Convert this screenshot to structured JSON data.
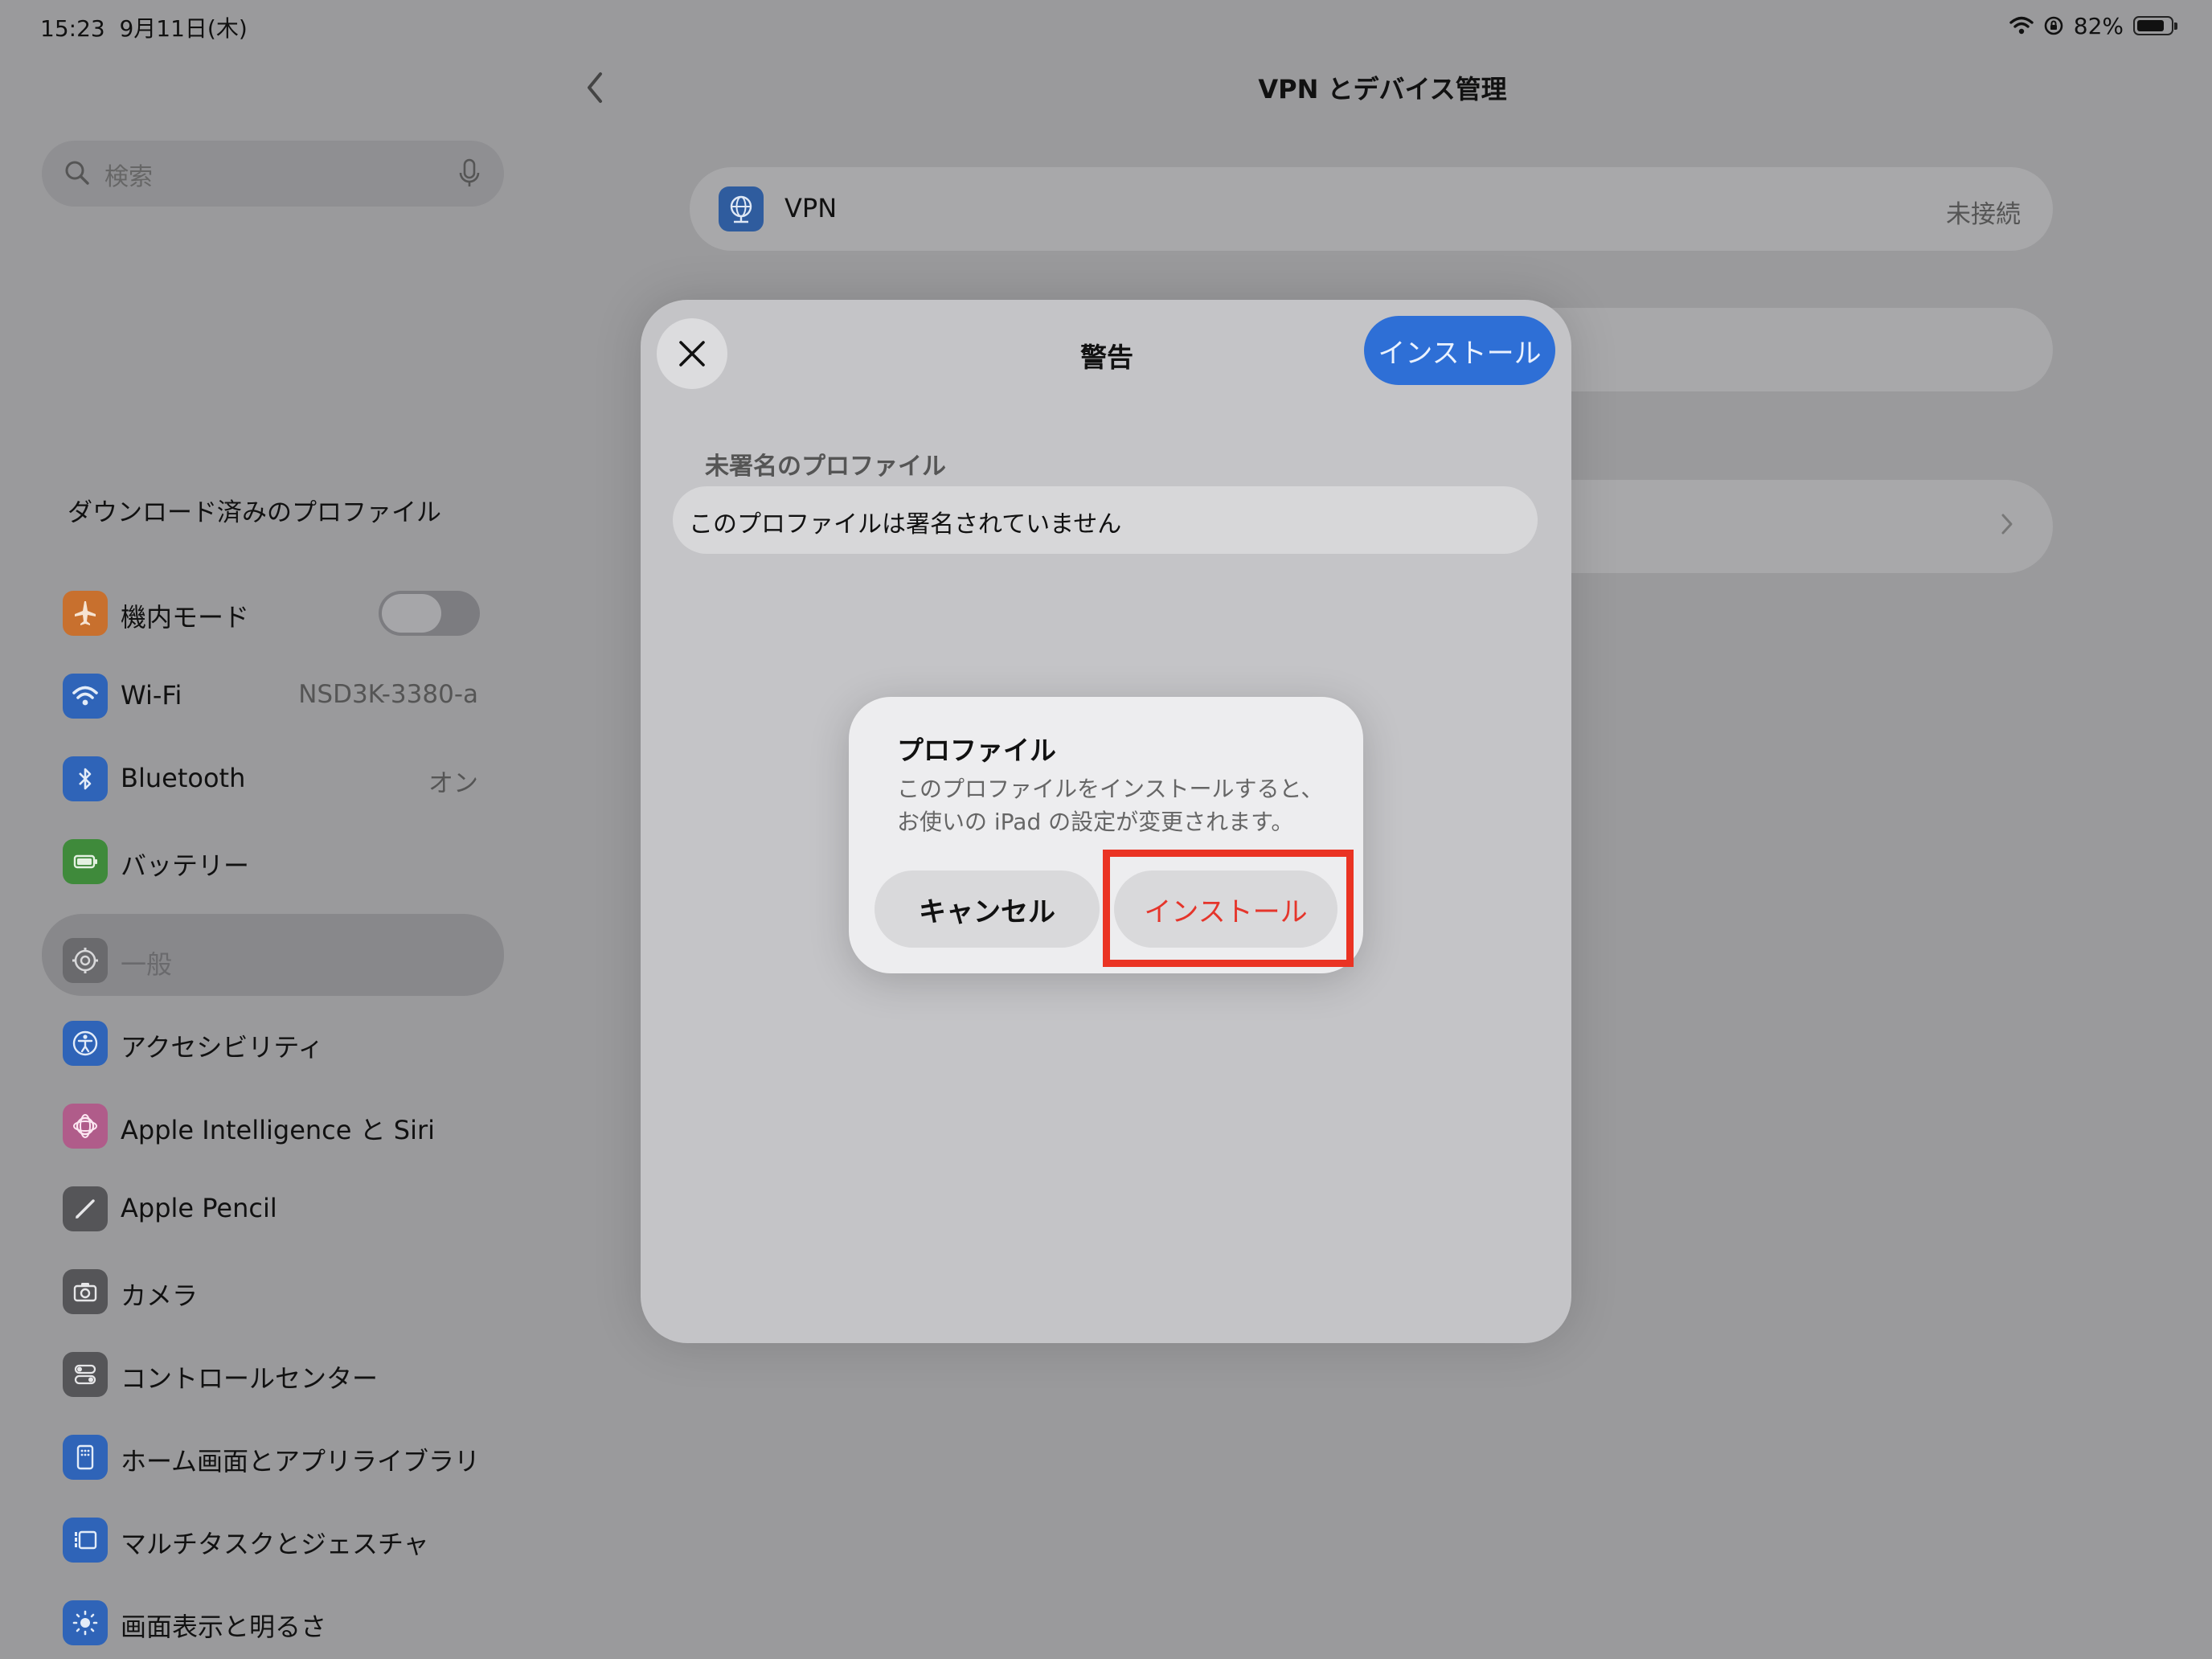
{
  "status_bar": {
    "time_date": "15:23  9月11日(木)",
    "battery_percent": "82%",
    "battery_level": 0.82
  },
  "sidebar": {
    "search_placeholder": "検索",
    "downloaded_profile": "ダウンロード済みのプロファイル",
    "items": [
      {
        "label": "機内モード",
        "icon": "airplane-icon",
        "color": "#c8702e",
        "toggle_on": false
      },
      {
        "label": "Wi-Fi",
        "value": "NSD3K-3380-a",
        "icon": "wifi-icon",
        "color": "#2f64b8"
      },
      {
        "label": "Bluetooth",
        "value": "オン",
        "icon": "bluetooth-icon",
        "color": "#2f64b8"
      },
      {
        "label": "バッテリー",
        "icon": "battery-icon",
        "color": "#3f8a3b"
      },
      {
        "label": "一般",
        "icon": "gear-icon",
        "color": "#6a6a6d",
        "selected": true
      },
      {
        "label": "アクセシビリティ",
        "icon": "accessibility-icon",
        "color": "#2f64b8"
      },
      {
        "label": "Apple Intelligence と Siri",
        "icon": "siri-icon",
        "color": "#b05c8a"
      },
      {
        "label": "Apple Pencil",
        "icon": "pencil-icon",
        "color": "#555558"
      },
      {
        "label": "カメラ",
        "icon": "camera-icon",
        "color": "#555558"
      },
      {
        "label": "コントロールセンター",
        "icon": "control-center-icon",
        "color": "#555558"
      },
      {
        "label": "ホーム画面とアプリライブラリ",
        "icon": "home-screen-icon",
        "color": "#2f64b8"
      },
      {
        "label": "マルチタスクとジェスチャ",
        "icon": "multitask-icon",
        "color": "#2f64b8"
      },
      {
        "label": "画面表示と明るさ",
        "icon": "brightness-icon",
        "color": "#2f64b8"
      }
    ]
  },
  "main": {
    "title": "VPN とデバイス管理",
    "vpn_label": "VPN",
    "vpn_status": "未接続"
  },
  "sheet": {
    "title": "警告",
    "install_label": "インストール",
    "section_header": "未署名のプロファイル",
    "unsigned_text": "このプロファイルは署名されていません"
  },
  "alert": {
    "title": "プロファイル",
    "message_line1": "このプロファイルをインストールすると、",
    "message_line2": "お使いの iPad の設定が変更されます。",
    "cancel_label": "キャンセル",
    "install_label": "インストール"
  },
  "colors": {
    "accent_blue": "#2e6fd6",
    "destructive_red": "#e5352b",
    "highlight_red": "#ea3323"
  }
}
